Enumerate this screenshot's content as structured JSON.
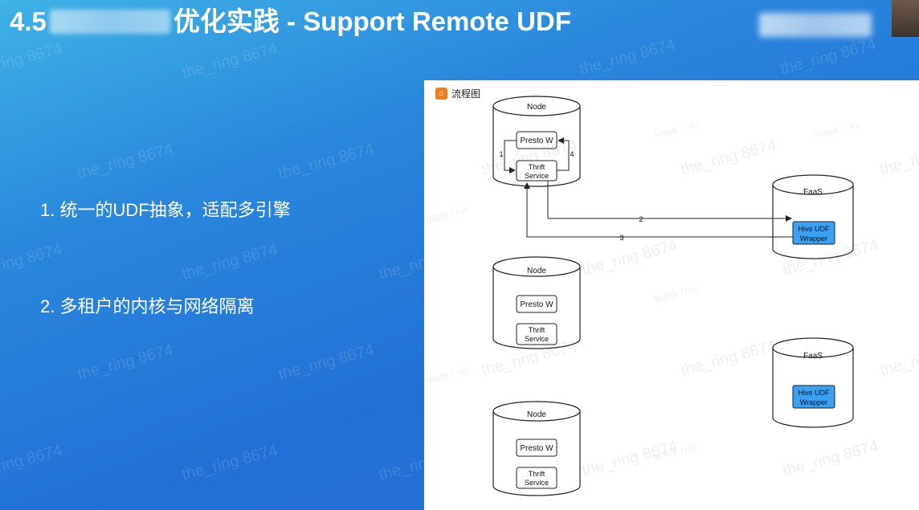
{
  "slide": {
    "title_prefix": "4.5",
    "title_suffix": "优化实践 - Support Remote UDF"
  },
  "bullets": [
    "1. 统一的UDF抽象，适配多引擎",
    "2. 多租户的内核与网络隔离"
  ],
  "diagram": {
    "header": "流程图",
    "nodes": [
      {
        "title": "Node",
        "box1": "Presto W",
        "box2_line1": "Thrift",
        "box2_line2": "Service"
      },
      {
        "title": "Node",
        "box1": "Presto W",
        "box2_line1": "Thrift",
        "box2_line2": "Service"
      },
      {
        "title": "Node",
        "box1": "Presto W",
        "box2_line1": "Thrift",
        "box2_line2": "Service"
      }
    ],
    "faas": [
      {
        "title": "FaaS",
        "box_line1": "Hive UDF",
        "box_line2": "Wrapper"
      },
      {
        "title": "FaaS",
        "box_line1": "Hive UDF",
        "box_line2": "Wrapper"
      }
    ],
    "edges": {
      "e1": "1",
      "e2": "2",
      "e3": "3",
      "e4": "4"
    },
    "accent_box_color": "#3b9ff2"
  },
  "watermarks": {
    "user": "the_ring 8674",
    "user_short": "ring 8674",
    "cn": "张晓琦 7730"
  }
}
